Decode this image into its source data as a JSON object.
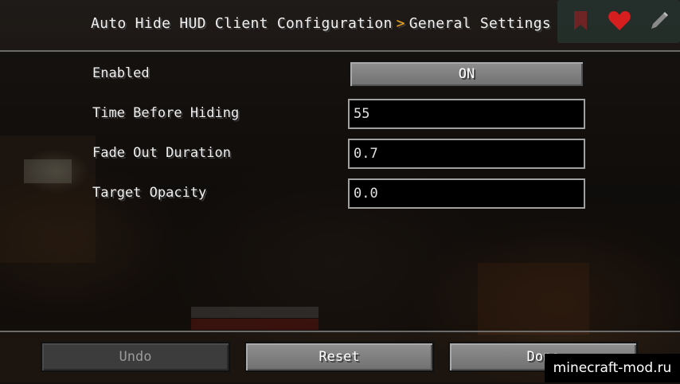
{
  "header": {
    "breadcrumb_parent": "Auto Hide HUD Client Configuration",
    "breadcrumb_separator": ">",
    "breadcrumb_current": "General Settings",
    "icons": [
      "bookmark-icon",
      "heart-icon",
      "pencil-icon"
    ]
  },
  "settings": {
    "enabled": {
      "label": "Enabled",
      "value": "ON"
    },
    "time_before_hiding": {
      "label": "Time Before Hiding",
      "value": "55"
    },
    "fade_out_duration": {
      "label": "Fade Out Duration",
      "value": "0.7"
    },
    "target_opacity": {
      "label": "Target Opacity",
      "value": "0.0"
    }
  },
  "footer": {
    "undo_label": "Undo",
    "reset_label": "Reset",
    "done_label": "Done"
  },
  "watermark": "minecraft-mod.ru",
  "colors": {
    "accent": "#f5a623",
    "heart": "#d61e1e"
  }
}
